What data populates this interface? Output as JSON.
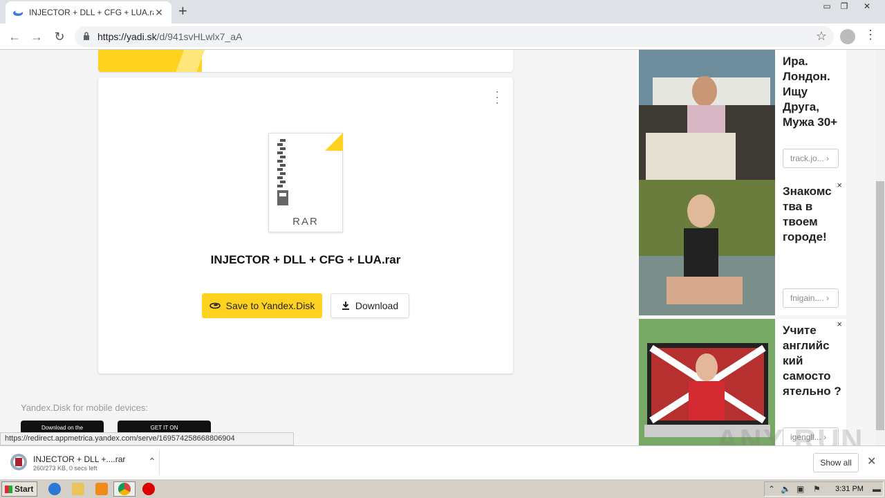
{
  "browser": {
    "tab_title": "INJECTOR + DLL + CFG + LUA.rar –",
    "url_host": "https://yadi.sk",
    "url_path": "/d/941svHLwlx7_aA"
  },
  "main": {
    "file_type": "RAR",
    "file_name": "INJECTOR + DLL + CFG + LUA.rar",
    "save_label": "Save to Yandex.Disk",
    "download_label": "Download",
    "mobile_label": "Yandex.Disk for mobile devices:",
    "app_store_label": "Download on the",
    "google_play_label": "GET IT ON"
  },
  "status_url": "https://redirect.appmetrica.yandex.com/serve/169574258668806904",
  "ads": [
    {
      "text": "Ира. Лондон. Ищу Друга, Мужа 30+",
      "link": "track.jo...",
      "close": ""
    },
    {
      "text": "Знакомс тва в твоем городе!",
      "link": "fnigain....",
      "close": "×"
    },
    {
      "text": "Учите английс кий самосто ятельно ?",
      "link": "igengll...",
      "close": "×"
    }
  ],
  "download_shelf": {
    "name": "INJECTOR + DLL +....rar",
    "status": "260/273 KB, 0 secs left",
    "show_all": "Show all"
  },
  "taskbar": {
    "start_label": "Start",
    "clock": "3:31 PM"
  },
  "watermark": "ANY RUN",
  "colors": {
    "accent": "#ffd21f",
    "page_bg": "#f5f5f5"
  }
}
